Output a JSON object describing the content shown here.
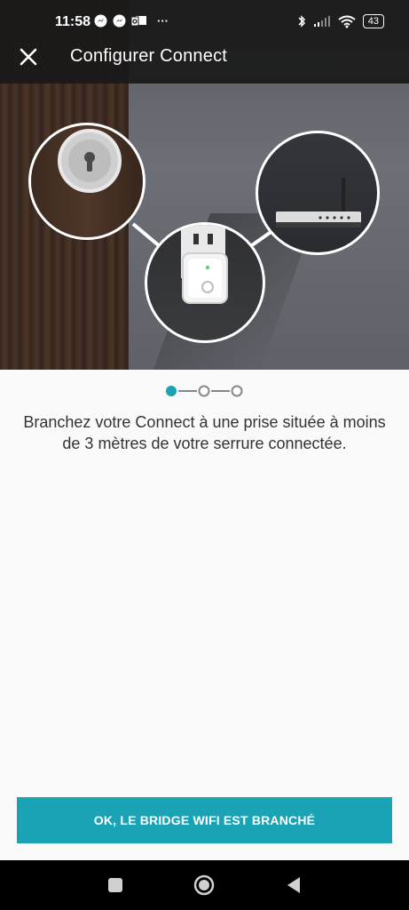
{
  "status_bar": {
    "time": "11:58",
    "icons_left": [
      "messenger-icon",
      "messenger-icon",
      "outlook-icon",
      "more-icon"
    ],
    "icons_right": [
      "bluetooth-icon",
      "signal-icon",
      "wifi-icon",
      "battery-icon"
    ],
    "battery": "43"
  },
  "app_bar": {
    "title": "Configurer Connect",
    "close_icon": "close-icon"
  },
  "illustration": {
    "items": [
      "keyhole-icon",
      "wifi-bridge-icon",
      "router-icon"
    ]
  },
  "stepper": {
    "steps": 3,
    "current": 1,
    "active_color": "#1aa3b5"
  },
  "instructions": {
    "text": "Branchez votre Connect à une prise située à moins de 3 mètres de votre serrure connectée."
  },
  "cta": {
    "label": "OK, LE BRIDGE WIFI EST BRANCHÉ",
    "color": "#1aa3b5"
  },
  "nav_bar": {
    "buttons": [
      "recents-icon",
      "home-icon",
      "back-icon"
    ]
  }
}
